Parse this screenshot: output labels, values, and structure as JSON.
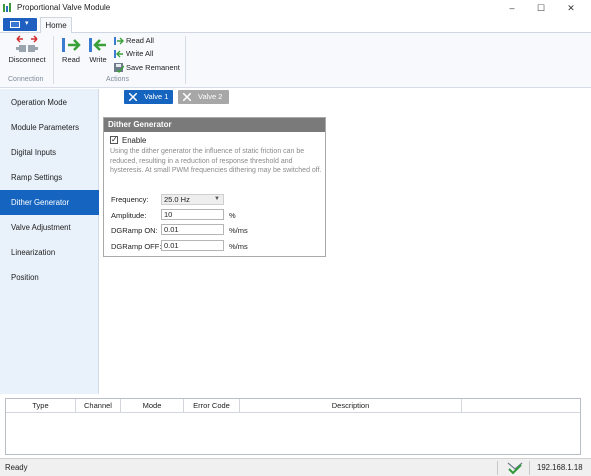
{
  "window": {
    "title": "Proportional Valve Module",
    "minimize": "–",
    "maximize": "☐",
    "close": "✕"
  },
  "ribbon": {
    "tab_home": "Home",
    "disconnect": "Disconnect",
    "read": "Read",
    "write": "Write",
    "read_all": "Read All",
    "write_all": "Write All",
    "save_remanent": "Save Remanent",
    "group_connection": "Connection",
    "group_actions": "Actions"
  },
  "sidebar": {
    "items": [
      {
        "label": "Operation Mode"
      },
      {
        "label": "Module Parameters"
      },
      {
        "label": "Digital Inputs"
      },
      {
        "label": "Ramp Settings"
      },
      {
        "label": "Dither Generator"
      },
      {
        "label": "Valve Adjustment"
      },
      {
        "label": "Linearization"
      },
      {
        "label": "Position"
      }
    ],
    "active_index": 4
  },
  "valve_tabs": [
    {
      "label": "Valve 1",
      "active": true
    },
    {
      "label": "Valve 2",
      "active": false
    }
  ],
  "dither": {
    "header": "Dither Generator",
    "enable_label": "Enable",
    "enabled": true,
    "description": "Using the dither generator the influence of static friction can be reduced, resulting in a reduction of response threshold and hysteresis. At small PWM frequencies dithering may be switched off.",
    "frequency_label": "Frequency:",
    "frequency_value": "25.0 Hz",
    "amplitude_label": "Amplitude:",
    "amplitude_value": "10",
    "amplitude_unit": "%",
    "ramp_on_label": "DGRamp ON:",
    "ramp_on_value": "0.01",
    "ramp_on_unit": "%/ms",
    "ramp_off_label": "DGRamp OFF:",
    "ramp_off_value": "0.01",
    "ramp_off_unit": "%/ms"
  },
  "error_table": {
    "columns": [
      "Type",
      "Channel",
      "Mode",
      "Error Code",
      "Description"
    ]
  },
  "status": {
    "text": "Ready",
    "ip": "192.168.1.18"
  },
  "colors": {
    "accent": "#1565c0",
    "sidebar_bg": "#e9f2fb",
    "panel_header": "#7a7a7a"
  }
}
